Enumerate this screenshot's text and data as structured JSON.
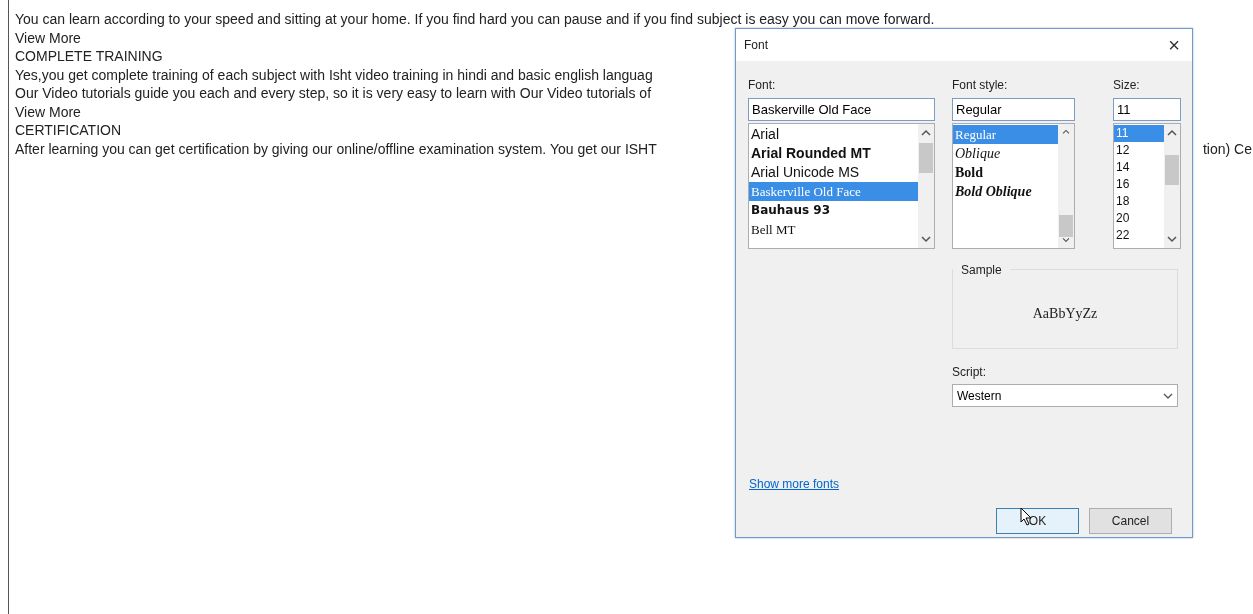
{
  "page": {
    "lines": [
      {
        "text": "You can learn according to your speed and sitting at your home. If you find hard you can pause and if you find subject is easy you can move forward."
      },
      {
        "text": "View More"
      },
      {
        "text": "COMPLETE TRAINING"
      },
      {
        "text": "Yes,you get complete training of each subject with Isht video training in hindi and basic english languag"
      },
      {
        "text": "Our Video tutorials guide you each and every step, so it is very easy to learn with Our Video tutorials of"
      },
      {
        "text": "View More"
      },
      {
        "text": "CERTIFICATION"
      },
      {
        "text": "After learning you can get certification by giving our online/offline examination system. You get our ISHT",
        "tail": "tion) Ce"
      }
    ]
  },
  "dialog": {
    "title": "Font",
    "close": "×",
    "font": {
      "label": "Font:",
      "value": "Baskerville Old Face",
      "items": [
        {
          "text": "Arial",
          "kind": "sans",
          "selected": false
        },
        {
          "text": "Arial Rounded MT",
          "kind": "sans-bold",
          "selected": false
        },
        {
          "text": "Arial Unicode MS",
          "kind": "sans",
          "selected": false
        },
        {
          "text": "Baskerville Old Face",
          "kind": "serif",
          "selected": true
        },
        {
          "text": "Bauhaus 93",
          "kind": "display",
          "selected": false
        },
        {
          "text": "Bell MT",
          "kind": "serif",
          "selected": false
        }
      ]
    },
    "style": {
      "label": "Font style:",
      "value": "Regular",
      "items": [
        {
          "text": "Regular",
          "kind": "serif",
          "selected": true
        },
        {
          "text": "Oblique",
          "kind": "serif-italic",
          "selected": false
        },
        {
          "text": "Bold",
          "kind": "serif-bold",
          "selected": false
        },
        {
          "text": "Bold Oblique",
          "kind": "serif-bold-italic",
          "selected": false
        }
      ]
    },
    "size": {
      "label": "Size:",
      "value": "11",
      "items": [
        {
          "text": "11",
          "selected": true
        },
        {
          "text": "12",
          "selected": false
        },
        {
          "text": "14",
          "selected": false
        },
        {
          "text": "16",
          "selected": false
        },
        {
          "text": "18",
          "selected": false
        },
        {
          "text": "20",
          "selected": false
        },
        {
          "text": "22",
          "selected": false
        }
      ]
    },
    "sample": {
      "label": "Sample",
      "text": "AaBbYyZz"
    },
    "script": {
      "label": "Script:",
      "value": "Western"
    },
    "link": "Show more fonts",
    "buttons": [
      {
        "text": "OK",
        "focused": true
      },
      {
        "text": "Cancel",
        "focused": false
      }
    ]
  }
}
